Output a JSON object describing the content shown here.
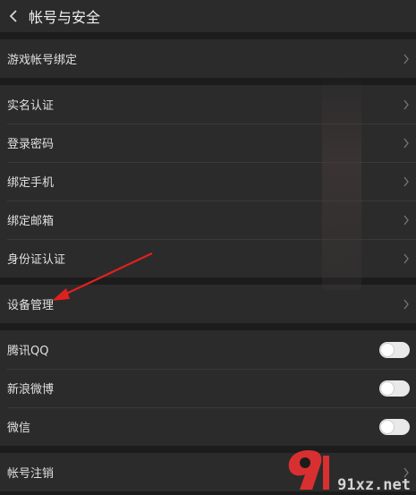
{
  "header": {
    "title": "帐号与安全"
  },
  "groups": [
    {
      "items": [
        {
          "label": "游戏帐号绑定",
          "control": "chevron"
        }
      ]
    },
    {
      "items": [
        {
          "label": "实名认证",
          "control": "chevron"
        },
        {
          "label": "登录密码",
          "control": "chevron"
        },
        {
          "label": "绑定手机",
          "control": "chevron"
        },
        {
          "label": "绑定邮箱",
          "control": "chevron"
        },
        {
          "label": "身份证认证",
          "control": "chevron"
        }
      ]
    },
    {
      "items": [
        {
          "label": "设备管理",
          "control": "chevron"
        }
      ]
    },
    {
      "items": [
        {
          "label": "腾讯QQ",
          "control": "toggle",
          "on": false
        },
        {
          "label": "新浪微博",
          "control": "toggle",
          "on": false
        },
        {
          "label": "微信",
          "control": "toggle",
          "on": false
        }
      ]
    },
    {
      "items": [
        {
          "label": "帐号注销",
          "control": "chevron"
        }
      ]
    }
  ],
  "watermark": {
    "text": "91xz.net",
    "color": "#d83030"
  },
  "colors": {
    "background": "#1c1c1c",
    "panel": "#2b2b2b",
    "annotation_arrow": "#e02020"
  },
  "icons": {
    "back": "chevron-left-icon",
    "row_action": "chevron-right-icon"
  }
}
